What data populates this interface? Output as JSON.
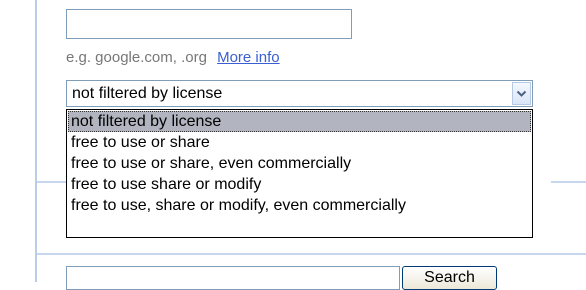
{
  "site_field": {
    "value": ""
  },
  "site_hint": {
    "text": "e.g. google.com, .org",
    "more_info_link": "More info"
  },
  "license_select": {
    "selected_value": "not filtered by license",
    "options": [
      {
        "label": "not filtered by license",
        "highlighted": true
      },
      {
        "label": "free to use or share",
        "highlighted": false
      },
      {
        "label": "free to use or share, even commercially",
        "highlighted": false
      },
      {
        "label": "free to use share or modify",
        "highlighted": false
      },
      {
        "label": "free to use, share or modify, even commercially",
        "highlighted": false
      }
    ]
  },
  "search": {
    "input_value": "",
    "button_label": "Search"
  },
  "icons": {
    "dropdown": "chevron-down-icon"
  },
  "colors": {
    "link": "#3b5fd0",
    "hint_text": "#777777",
    "highlight": "#b2b4bf",
    "frame_line": "#b9cde6"
  }
}
